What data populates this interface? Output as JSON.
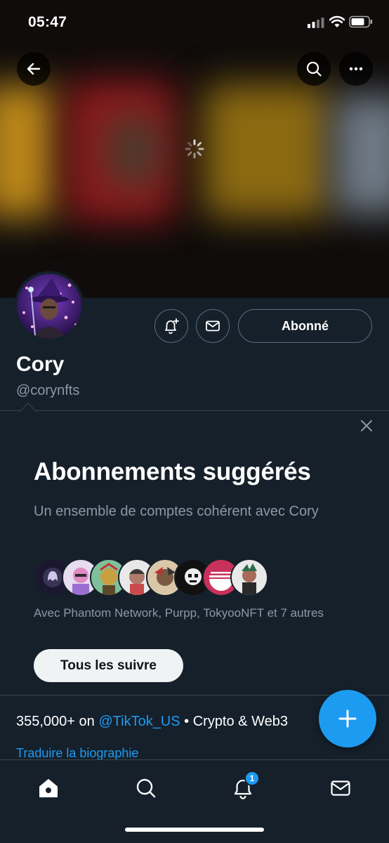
{
  "status_bar": {
    "time": "05:47"
  },
  "profile": {
    "name": "Cory",
    "handle": "@corynfts",
    "follow_label": "Abonné"
  },
  "suggestions": {
    "title": "Abonnements suggérés",
    "subtitle": "Un ensemble de comptes cohérent avec Cory",
    "with_text": "Avec Phantom Network, Purpp, TokyooNFT et 7 autres",
    "follow_all_label": "Tous les suivre"
  },
  "bio": {
    "prefix": "355,000+ on ",
    "mention": "@TikTok_US",
    "suffix": " • Crypto & Web3",
    "translate_label": "Traduire la biographie"
  },
  "nav": {
    "notifications_badge": "1"
  },
  "colors": {
    "background": "#15202b",
    "accent": "#1d9bf0",
    "border": "#38444d",
    "secondary_text": "#8b98a5"
  }
}
